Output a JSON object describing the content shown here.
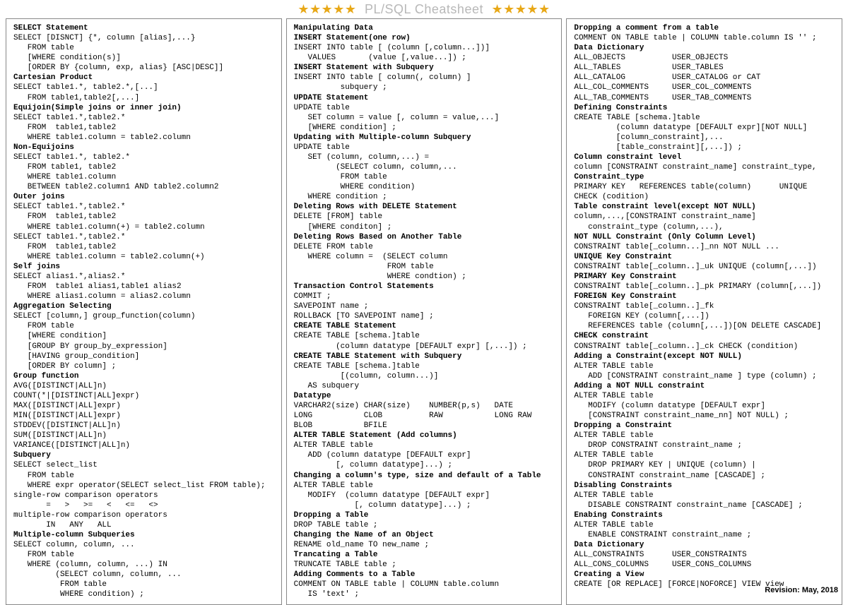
{
  "title": {
    "stars": "★★★★★",
    "text": "PL/SQL Cheatsheet"
  },
  "footer": "Revision: May, 2018",
  "col1": [
    {
      "t": "h",
      "v": "SELECT Statement"
    },
    {
      "t": "l",
      "v": "SELECT [DISNCT] {*, column [alias],...}"
    },
    {
      "t": "l",
      "v": "   FROM table"
    },
    {
      "t": "l",
      "v": "   [WHERE condition(s)]"
    },
    {
      "t": "l",
      "v": "   [ORDER BY {column, exp, alias} [ASC|DESC]]"
    },
    {
      "t": "h",
      "v": "Cartesian Product"
    },
    {
      "t": "l",
      "v": "SELECT table1.*, table2.*,[...]"
    },
    {
      "t": "l",
      "v": "   FROM table1,table2[,...]"
    },
    {
      "t": "h",
      "v": "Equijoin(Simple joins or inner join)"
    },
    {
      "t": "l",
      "v": "SELECT table1.*,table2.*"
    },
    {
      "t": "l",
      "v": "   FROM  table1,table2"
    },
    {
      "t": "l",
      "v": "   WHERE table1.column = table2.column"
    },
    {
      "t": "h",
      "v": "Non-Equijoins"
    },
    {
      "t": "l",
      "v": "SELECT table1.*, table2.*"
    },
    {
      "t": "l",
      "v": "   FROM table1, table2"
    },
    {
      "t": "l",
      "v": "   WHERE table1.column"
    },
    {
      "t": "l",
      "v": "   BETWEEN table2.column1 AND table2.column2"
    },
    {
      "t": "h",
      "v": "Outer joins"
    },
    {
      "t": "l",
      "v": "SELECT table1.*,table2.*"
    },
    {
      "t": "l",
      "v": "   FROM  table1,table2"
    },
    {
      "t": "l",
      "v": "   WHERE table1.column(+) = table2.column"
    },
    {
      "t": "l",
      "v": "SELECT table1.*,table2.*"
    },
    {
      "t": "l",
      "v": "   FROM  table1,table2"
    },
    {
      "t": "l",
      "v": "   WHERE table1.column = table2.column(+)"
    },
    {
      "t": "h",
      "v": "Self joins"
    },
    {
      "t": "l",
      "v": "SELECT alias1.*,alias2.*"
    },
    {
      "t": "l",
      "v": "   FROM  table1 alias1,table1 alias2"
    },
    {
      "t": "l",
      "v": "   WHERE alias1.column = alias2.column"
    },
    {
      "t": "h",
      "v": "Aggregation Selecting"
    },
    {
      "t": "l",
      "v": "SELECT [column,] group_function(column)"
    },
    {
      "t": "l",
      "v": "   FROM table"
    },
    {
      "t": "l",
      "v": "   [WHERE condition]"
    },
    {
      "t": "l",
      "v": "   [GROUP BY group_by_expression]"
    },
    {
      "t": "l",
      "v": "   [HAVING group_condition]"
    },
    {
      "t": "l",
      "v": "   [ORDER BY column] ;"
    },
    {
      "t": "h",
      "v": "Group function"
    },
    {
      "t": "l",
      "v": "AVG([DISTINCT|ALL]n)"
    },
    {
      "t": "l",
      "v": "COUNT(*|[DISTINCT|ALL]expr)"
    },
    {
      "t": "l",
      "v": "MAX([DISTINCT|ALL]expr)"
    },
    {
      "t": "l",
      "v": "MIN([DISTINCT|ALL]expr)"
    },
    {
      "t": "l",
      "v": "STDDEV([DISTINCT|ALL]n)"
    },
    {
      "t": "l",
      "v": "SUM([DISTINCT|ALL]n)"
    },
    {
      "t": "l",
      "v": "VARIANCE([DISTINCT|ALL]n)"
    },
    {
      "t": "h",
      "v": "Subquery"
    },
    {
      "t": "l",
      "v": "SELECT select_list"
    },
    {
      "t": "l",
      "v": "   FROM table"
    },
    {
      "t": "l",
      "v": "   WHERE expr operator(SELECT select_list FROM table);"
    },
    {
      "t": "l",
      "v": "single-row comparison operators"
    },
    {
      "t": "l",
      "v": "       =   >   >=   <   <=   <>"
    },
    {
      "t": "l",
      "v": "multiple-row comparison operators"
    },
    {
      "t": "l",
      "v": "       IN   ANY   ALL"
    },
    {
      "t": "h",
      "v": "Multiple-column Subqueries"
    },
    {
      "t": "l",
      "v": "SELECT column, column, ..."
    },
    {
      "t": "l",
      "v": "   FROM table"
    },
    {
      "t": "l",
      "v": "   WHERE (column, column, ...) IN"
    },
    {
      "t": "l",
      "v": "         (SELECT column, column, ..."
    },
    {
      "t": "l",
      "v": "          FROM table"
    },
    {
      "t": "l",
      "v": "          WHERE condition) ;"
    }
  ],
  "col2": [
    {
      "t": "h",
      "v": "Manipulating Data"
    },
    {
      "t": "h",
      "v": "INSERT Statement(one row)"
    },
    {
      "t": "l",
      "v": "INSERT INTO table [ (column [,column...])]"
    },
    {
      "t": "l",
      "v": "   VALUES       (value [,value...]) ;"
    },
    {
      "t": "h",
      "v": "INSERT Statement with Subquery"
    },
    {
      "t": "l",
      "v": "INSERT INTO table [ column(, column) ]"
    },
    {
      "t": "l",
      "v": "          subquery ;"
    },
    {
      "t": "h",
      "v": "UPDATE Statement"
    },
    {
      "t": "l",
      "v": "UPDATE table"
    },
    {
      "t": "l",
      "v": "   SET column = value [, column = value,...]"
    },
    {
      "t": "l",
      "v": "   [WHERE condition] ;"
    },
    {
      "t": "h",
      "v": "Updating with Multiple-column Subquery"
    },
    {
      "t": "l",
      "v": "UPDATE table"
    },
    {
      "t": "l",
      "v": "   SET (column, column,...) ="
    },
    {
      "t": "l",
      "v": "         (SELECT column, column,..."
    },
    {
      "t": "l",
      "v": "          FROM table"
    },
    {
      "t": "l",
      "v": "          WHERE condition)"
    },
    {
      "t": "l",
      "v": "   WHERE condition ;"
    },
    {
      "t": "h",
      "v": "Deleting Rows with DELETE Statement"
    },
    {
      "t": "l",
      "v": "DELETE [FROM] table"
    },
    {
      "t": "l",
      "v": "   [WHERE conditon] ;"
    },
    {
      "t": "h",
      "v": "Deleting Rows Based on Another Table"
    },
    {
      "t": "l",
      "v": "DELETE FROM table"
    },
    {
      "t": "l",
      "v": "   WHERE column =  (SELECT column"
    },
    {
      "t": "l",
      "v": "                    FROM table"
    },
    {
      "t": "l",
      "v": "                    WHERE condtion) ;"
    },
    {
      "t": "h",
      "v": "Transaction Control Statements"
    },
    {
      "t": "l",
      "v": "COMMIT ;"
    },
    {
      "t": "l",
      "v": "SAVEPOINT name ;"
    },
    {
      "t": "l",
      "v": "ROLLBACK [TO SAVEPOINT name] ;"
    },
    {
      "t": "h",
      "v": "CREATE TABLE Statement"
    },
    {
      "t": "l",
      "v": "CREATE TABLE [schema.]table"
    },
    {
      "t": "l",
      "v": "         (column datatype [DEFAULT expr] [,...]) ;"
    },
    {
      "t": "h",
      "v": "CREATE TABLE Statement with Subquery"
    },
    {
      "t": "l",
      "v": "CREATE TABLE [schema.]table"
    },
    {
      "t": "l",
      "v": "          [(column, column...)]"
    },
    {
      "t": "l",
      "v": "   AS subquery"
    },
    {
      "t": "h",
      "v": "Datatype"
    },
    {
      "t": "l",
      "v": "VARCHAR2(size) CHAR(size)    NUMBER(p,s)   DATE"
    },
    {
      "t": "l",
      "v": "LONG           CLOB          RAW           LONG RAW"
    },
    {
      "t": "l",
      "v": "BLOB           BFILE"
    },
    {
      "t": "h",
      "v": "ALTER TABLE Statement (Add columns)"
    },
    {
      "t": "l",
      "v": "ALTER TABLE table"
    },
    {
      "t": "l",
      "v": "   ADD (column datatype [DEFAULT expr]"
    },
    {
      "t": "l",
      "v": "         [, column datatype]...) ;"
    },
    {
      "t": "h",
      "v": "Changing a column's type, size and default of a Table"
    },
    {
      "t": "l",
      "v": "ALTER TABLE table"
    },
    {
      "t": "l",
      "v": "   MODIFY  (column datatype [DEFAULT expr]"
    },
    {
      "t": "l",
      "v": "             [, column datatype]...) ;"
    },
    {
      "t": "h",
      "v": "Dropping a Table"
    },
    {
      "t": "l",
      "v": "DROP TABLE table ;"
    },
    {
      "t": "h",
      "v": "Changing the Name of an Object"
    },
    {
      "t": "l",
      "v": "RENAME old_name TO new_name ;"
    },
    {
      "t": "h",
      "v": "Trancating a Table"
    },
    {
      "t": "l",
      "v": "TRUNCATE TABLE table ;"
    },
    {
      "t": "h",
      "v": "Adding Comments to a Table"
    },
    {
      "t": "l",
      "v": "COMMENT ON TABLE table | COLUMN table.column"
    },
    {
      "t": "l",
      "v": "   IS 'text' ;"
    }
  ],
  "col3": [
    {
      "t": "h",
      "v": "Dropping a comment from a table"
    },
    {
      "t": "l",
      "v": "COMMENT ON TABLE table | COLUMN table.column IS '' ;"
    },
    {
      "t": "h",
      "v": "Data Dictionary"
    },
    {
      "t": "l",
      "v": "ALL_OBJECTS          USER_OBJECTS"
    },
    {
      "t": "l",
      "v": "ALL_TABLES           USER_TABLES"
    },
    {
      "t": "l",
      "v": "ALL_CATALOG          USER_CATALOG or CAT"
    },
    {
      "t": "l",
      "v": "ALL_COL_COMMENTS     USER_COL_COMMENTS"
    },
    {
      "t": "l",
      "v": "ALL_TAB_COMMENTS     USER_TAB_COMMENTS"
    },
    {
      "t": "h",
      "v": "Defining Constraints"
    },
    {
      "t": "l",
      "v": "CREATE TABLE [schema.]table"
    },
    {
      "t": "l",
      "v": "         (column datatype [DEFAULT expr][NOT NULL]"
    },
    {
      "t": "l",
      "v": "         [column_constraint],..."
    },
    {
      "t": "l",
      "v": "         [table_constraint][,...]) ;"
    },
    {
      "t": "h",
      "v": "Column constraint level"
    },
    {
      "t": "l",
      "v": "column [CONSTRAINT constraint_name] constraint_type,"
    },
    {
      "t": "h",
      "v": "Constraint_type"
    },
    {
      "t": "l",
      "v": "PRIMARY KEY   REFERENCES table(column)      UNIQUE"
    },
    {
      "t": "l",
      "v": "CHECK (codition)"
    },
    {
      "t": "h",
      "v": "Table constraint level(except NOT NULL)"
    },
    {
      "t": "l",
      "v": "column,...,[CONSTRAINT constraint_name]"
    },
    {
      "t": "l",
      "v": "   constraint_type (column,...),"
    },
    {
      "t": "h",
      "v": "NOT NULL Constraint (Only Column Level)"
    },
    {
      "t": "l",
      "v": "CONSTRAINT table[_column...]_nn NOT NULL ..."
    },
    {
      "t": "h",
      "v": "UNIQUE Key Constraint"
    },
    {
      "t": "l",
      "v": "CONSTRAINT table[_column..]_uk UNIQUE (column[,...])"
    },
    {
      "t": "h",
      "v": "PRIMARY Key Constraint"
    },
    {
      "t": "l",
      "v": "CONSTRAINT table[_column..]_pk PRIMARY (column[,...])"
    },
    {
      "t": "h",
      "v": "FOREIGN Key Constraint"
    },
    {
      "t": "l",
      "v": "CONSTRAINT table[_column..]_fk"
    },
    {
      "t": "l",
      "v": "   FOREIGN KEY (column[,...])"
    },
    {
      "t": "l",
      "v": "   REFERENCES table (column[,...])[ON DELETE CASCADE]"
    },
    {
      "t": "h",
      "v": "CHECK constraint"
    },
    {
      "t": "l",
      "v": "CONSTRAINT table[_column..]_ck CHECK (condition)"
    },
    {
      "t": "h",
      "v": "Adding a Constraint(except NOT NULL)"
    },
    {
      "t": "l",
      "v": "ALTER TABLE table"
    },
    {
      "t": "l",
      "v": "   ADD [CONSTRAINT constraint_name ] type (column) ;"
    },
    {
      "t": "h",
      "v": "Adding a NOT NULL constraint"
    },
    {
      "t": "l",
      "v": "ALTER TABLE table"
    },
    {
      "t": "l",
      "v": "   MODIFY (column datatype [DEFAULT expr]"
    },
    {
      "t": "l",
      "v": "   [CONSTRAINT constraint_name_nn] NOT NULL) ;"
    },
    {
      "t": "h",
      "v": "Dropping a Constraint"
    },
    {
      "t": "l",
      "v": "ALTER TABLE table"
    },
    {
      "t": "l",
      "v": "   DROP CONSTRAINT constraint_name ;"
    },
    {
      "t": "l",
      "v": "ALTER TABLE table"
    },
    {
      "t": "l",
      "v": "   DROP PRIMARY KEY | UNIQUE (column) |"
    },
    {
      "t": "l",
      "v": "   CONSTRAINT constraint_name [CASCADE] ;"
    },
    {
      "t": "h",
      "v": "Disabling Constraints"
    },
    {
      "t": "l",
      "v": "ALTER TABLE table"
    },
    {
      "t": "l",
      "v": "   DISABLE CONSTRAINT constraint_name [CASCADE] ;"
    },
    {
      "t": "h",
      "v": "Enabing Constraints"
    },
    {
      "t": "l",
      "v": "ALTER TABLE table"
    },
    {
      "t": "l",
      "v": "   ENABLE CONSTRAINT constraint_name ;"
    },
    {
      "t": "h",
      "v": "Data Dictionary"
    },
    {
      "t": "l",
      "v": "ALL_CONSTRAINTS      USER_CONSTRAINTS"
    },
    {
      "t": "l",
      "v": "ALL_CONS_COLUMNS     USER_CONS_COLUMNS"
    },
    {
      "t": "h",
      "v": "Creating a View"
    },
    {
      "t": "l",
      "v": "CREATE [OR REPLACE] [FORCE|NOFORCE] VIEW view"
    }
  ]
}
